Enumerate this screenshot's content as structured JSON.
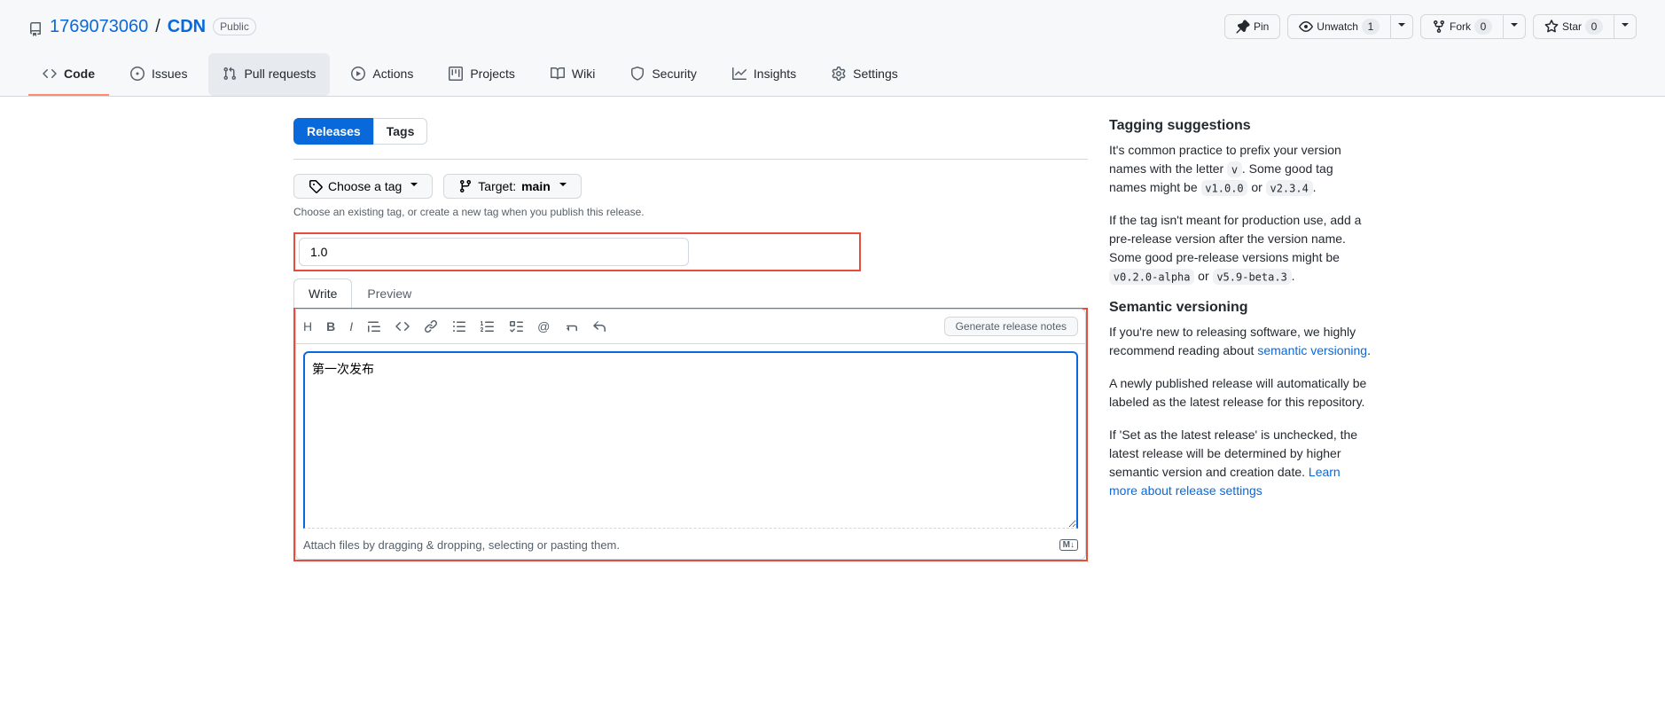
{
  "repo": {
    "owner": "1769073060",
    "name": "CDN",
    "visibility": "Public"
  },
  "actions": {
    "pin": "Pin",
    "unwatch": "Unwatch",
    "unwatch_count": "1",
    "fork": "Fork",
    "fork_count": "0",
    "star": "Star",
    "star_count": "0"
  },
  "nav": {
    "code": "Code",
    "issues": "Issues",
    "pulls": "Pull requests",
    "actions": "Actions",
    "projects": "Projects",
    "wiki": "Wiki",
    "security": "Security",
    "insights": "Insights",
    "settings": "Settings"
  },
  "subnav": {
    "releases": "Releases",
    "tags": "Tags"
  },
  "form": {
    "choose_tag": "Choose a tag",
    "target_label": "Target:",
    "target_branch": "main",
    "tag_hint": "Choose an existing tag, or create a new tag when you publish this release.",
    "title_value": "1.0",
    "write_tab": "Write",
    "preview_tab": "Preview",
    "gen_notes": "Generate release notes",
    "description_value": "第一次发布",
    "attach_hint": "Attach files by dragging & dropping, selecting or pasting them.",
    "md_badge": "M↓"
  },
  "sidebar": {
    "tagging_title": "Tagging suggestions",
    "tagging_p1_a": "It's common practice to prefix your version names with the letter ",
    "tagging_p1_code1": "v",
    "tagging_p1_b": ". Some good tag names might be ",
    "tagging_p1_code2": "v1.0.0",
    "tagging_p1_c": " or ",
    "tagging_p1_code3": "v2.3.4",
    "tagging_p1_d": ".",
    "tagging_p2_a": "If the tag isn't meant for production use, add a pre-release version after the version name. Some good pre-release versions might be ",
    "tagging_p2_code1": "v0.2.0-alpha",
    "tagging_p2_b": " or ",
    "tagging_p2_code2": "v5.9-beta.3",
    "tagging_p2_c": ".",
    "semver_title": "Semantic versioning",
    "semver_p1_a": "If you're new to releasing software, we highly recommend reading about ",
    "semver_link": "semantic versioning",
    "semver_p1_b": ".",
    "semver_p2": "A newly published release will automatically be labeled as the latest release for this repository.",
    "semver_p3_a": "If 'Set as the latest release' is unchecked, the latest release will be determined by higher semantic version and creation date. ",
    "semver_link2": "Learn more about release settings"
  }
}
